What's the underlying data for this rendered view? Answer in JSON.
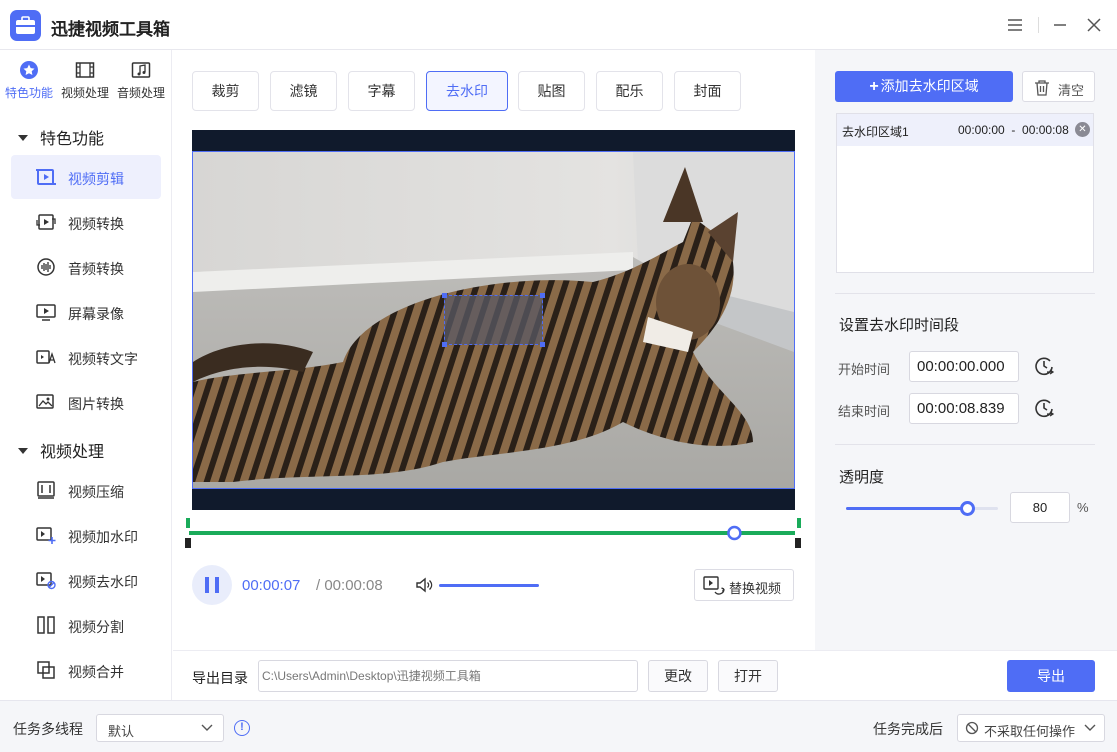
{
  "app": {
    "title": "迅捷视频工具箱"
  },
  "sidebar": {
    "top_tabs": [
      {
        "label": "特色功能",
        "icon": "star-icon"
      },
      {
        "label": "视频处理",
        "icon": "film-icon"
      },
      {
        "label": "音频处理",
        "icon": "music-icon"
      }
    ],
    "groups": [
      {
        "label": "特色功能"
      },
      {
        "label": "视频处理"
      }
    ],
    "items": [
      {
        "label": "视频剪辑",
        "icon": "video-cut-icon"
      },
      {
        "label": "视频转换",
        "icon": "video-convert-icon"
      },
      {
        "label": "音频转换",
        "icon": "audio-wave-icon"
      },
      {
        "label": "屏幕录像",
        "icon": "screen-record-icon"
      },
      {
        "label": "视频转文字",
        "icon": "video-to-text-icon"
      },
      {
        "label": "图片转换",
        "icon": "image-convert-icon"
      },
      {
        "label": "视频压缩",
        "icon": "compress-icon"
      },
      {
        "label": "视频加水印",
        "icon": "add-watermark-icon"
      },
      {
        "label": "视频去水印",
        "icon": "remove-watermark-icon"
      },
      {
        "label": "视频分割",
        "icon": "split-icon"
      },
      {
        "label": "视频合并",
        "icon": "merge-icon"
      }
    ]
  },
  "toolbar": {
    "tabs": [
      {
        "label": "裁剪"
      },
      {
        "label": "滤镜"
      },
      {
        "label": "字幕"
      },
      {
        "label": "去水印"
      },
      {
        "label": "贴图"
      },
      {
        "label": "配乐"
      },
      {
        "label": "封面"
      }
    ],
    "active_tab": "去水印"
  },
  "player": {
    "current_time": "00:00:07",
    "separator": " / ",
    "total_time": "00:00:08",
    "progress": 0.9,
    "replace_label": "替换视频"
  },
  "right_panel": {
    "add_region_label": "添加去水印区域",
    "clear_label": "清空",
    "regions": [
      {
        "name": "去水印区域1",
        "range": "00:00:00  -  00:00:08"
      }
    ],
    "time_section_title": "设置去水印时间段",
    "start_label": "开始时间",
    "start_value": "00:00:00.000",
    "end_label": "结束时间",
    "end_value": "00:00:08.839",
    "opacity_title": "透明度",
    "opacity_value": "80",
    "opacity_unit": "%"
  },
  "export": {
    "label": "导出目录",
    "path": "C:\\Users\\Admin\\Desktop\\迅捷视频工具箱",
    "change_label": "更改",
    "open_label": "打开",
    "export_label": "导出"
  },
  "statusbar": {
    "threads_label": "任务多线程",
    "threads_value": "默认",
    "after_label": "任务完成后",
    "after_value": "不采取任何操作"
  },
  "colors": {
    "accent": "#4f6df5",
    "timeline_green": "#1aab5a"
  }
}
